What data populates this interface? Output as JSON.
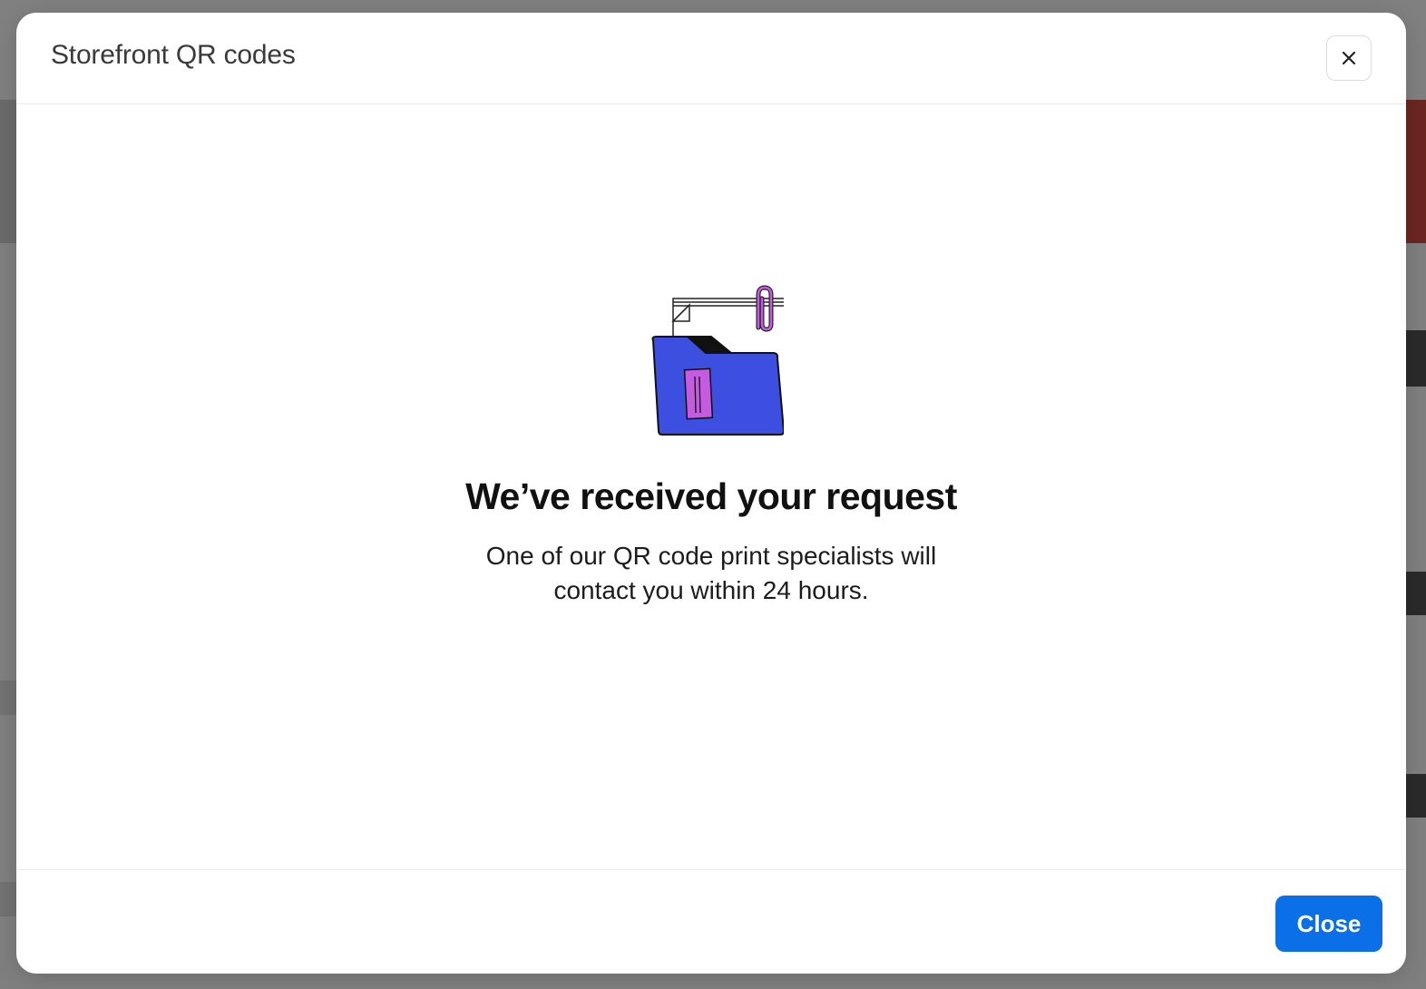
{
  "modal": {
    "title": "Storefront QR codes",
    "close_icon": "close-icon",
    "illustration_icon": "folder-with-documents-illustration",
    "headline": "We’ve received your request",
    "body_line1": "One of our QR code print specialists will",
    "body_line2": "contact you within 24 hours.",
    "close_button_label": "Close"
  },
  "colors": {
    "primary_button": "#0b6fe8",
    "folder_blue": "#3d4fe0",
    "accent_purple": "#c55be0"
  }
}
